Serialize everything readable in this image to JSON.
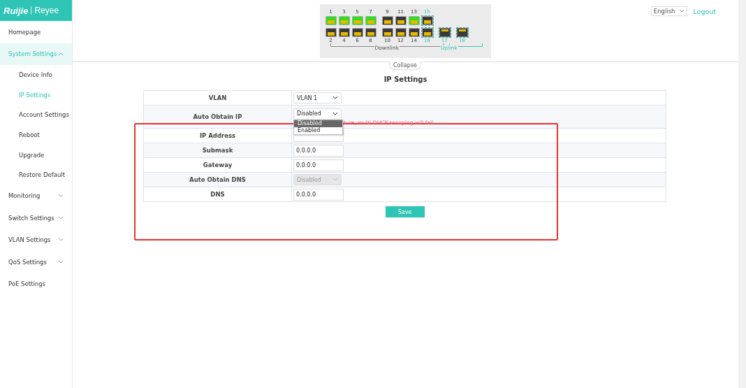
{
  "logo": {
    "brand": "Ruijie",
    "sub_brand": "Reyee"
  },
  "sidebar": {
    "items": [
      {
        "label": "Homepage",
        "selected": false
      },
      {
        "label": "System Settings",
        "selected": true,
        "expanded": true,
        "children": [
          {
            "label": "Device Info",
            "selected": false
          },
          {
            "label": "IP Settings",
            "selected": true
          },
          {
            "label": "Account Settings",
            "selected": false
          },
          {
            "label": "Reboot",
            "selected": false
          },
          {
            "label": "Upgrade",
            "selected": false
          },
          {
            "label": "Restore Default",
            "selected": false
          }
        ]
      },
      {
        "label": "Monitoring",
        "selected": false,
        "expanded": false
      },
      {
        "label": "Switch Settings",
        "selected": false,
        "expanded": false
      },
      {
        "label": "VLAN Settings",
        "selected": false,
        "expanded": false
      },
      {
        "label": "QoS Settings",
        "selected": false,
        "expanded": false
      },
      {
        "label": "PoE Settings",
        "selected": false
      }
    ]
  },
  "header": {
    "language": "English",
    "logout": "Logout"
  },
  "switch_panel": {
    "top_ports": [
      {
        "number": "1",
        "kind": "rj45",
        "link_up": true,
        "uplink": false
      },
      {
        "number": "3",
        "kind": "rj45",
        "link_up": true,
        "uplink": false
      },
      {
        "number": "5",
        "kind": "rj45",
        "link_up": true,
        "uplink": false
      },
      {
        "number": "7",
        "kind": "rj45",
        "link_up": true,
        "uplink": false
      },
      {
        "number": "9",
        "kind": "rj45",
        "link_up": false,
        "uplink": false
      },
      {
        "number": "11",
        "kind": "rj45",
        "link_up": false,
        "uplink": false
      },
      {
        "number": "13",
        "kind": "rj45",
        "link_up": true,
        "uplink": false
      },
      {
        "number": "15",
        "kind": "rj45",
        "link_up": false,
        "uplink": true
      }
    ],
    "bottom_ports": [
      {
        "number": "2",
        "kind": "rj45",
        "link_up": false,
        "uplink": false
      },
      {
        "number": "4",
        "kind": "rj45",
        "link_up": false,
        "uplink": false
      },
      {
        "number": "6",
        "kind": "rj45",
        "link_up": false,
        "uplink": false
      },
      {
        "number": "8",
        "kind": "rj45",
        "link_up": false,
        "uplink": false
      },
      {
        "number": "10",
        "kind": "rj45",
        "link_up": false,
        "uplink": false
      },
      {
        "number": "12",
        "kind": "rj45",
        "link_up": false,
        "uplink": false
      },
      {
        "number": "14",
        "kind": "rj45",
        "link_up": false,
        "uplink": false
      },
      {
        "number": "16",
        "kind": "rj45",
        "link_up": false,
        "uplink": true
      },
      {
        "number": "17",
        "kind": "sfp",
        "link_up": false,
        "uplink": true
      },
      {
        "number": "18",
        "kind": "sfp",
        "link_up": false,
        "uplink": true
      }
    ],
    "downlink_label": "Downlink",
    "uplink_label": "Uplink",
    "collapse": "Collapse"
  },
  "page_title": "IP Settings",
  "form": {
    "rows": [
      {
        "label": "VLAN",
        "kind": "select",
        "value": "VLAN 1",
        "disabled": false
      },
      {
        "label": "Auto Obtain IP",
        "kind": "select",
        "value": "Disabled",
        "disabled": false,
        "hint": "ture, multi-DHCP snooping will fail",
        "options": [
          {
            "label": "Disabled",
            "selected": true
          },
          {
            "label": "Enabled",
            "selected": false
          }
        ]
      },
      {
        "label": "IP Address",
        "kind": "input"
      },
      {
        "label": "Submask",
        "kind": "input",
        "value": "0.0.0.0"
      },
      {
        "label": "Gateway",
        "kind": "input",
        "value": "0.0.0.0"
      },
      {
        "label": "Auto Obtain DNS",
        "kind": "select",
        "value": "Disabled",
        "disabled": true
      },
      {
        "label": "DNS",
        "kind": "input",
        "value": "0.0.0.0"
      }
    ],
    "save": "Save"
  }
}
